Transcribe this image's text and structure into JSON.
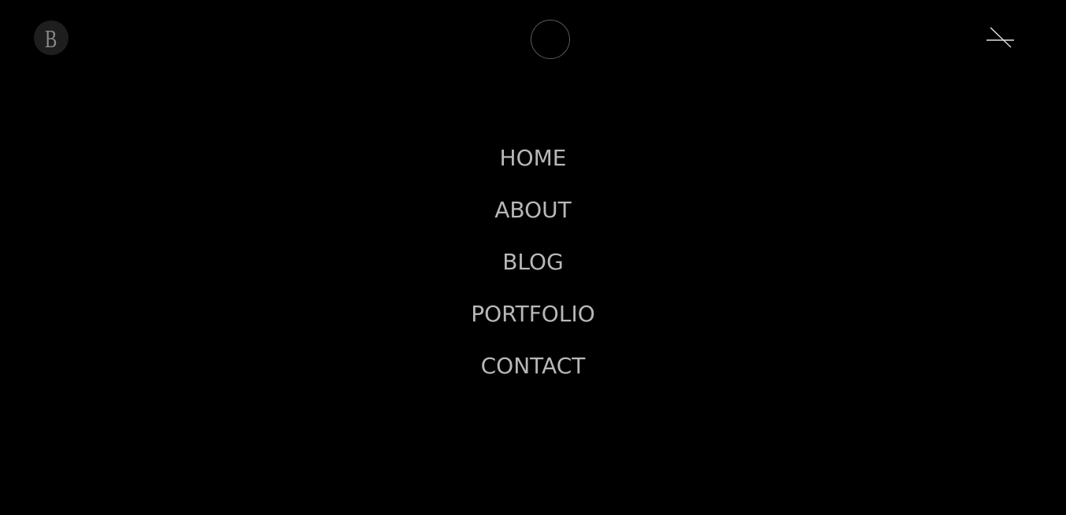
{
  "logo": {
    "letter": "B"
  },
  "nav": {
    "items": [
      {
        "label": "HOME"
      },
      {
        "label": "ABOUT"
      },
      {
        "label": "BLOG"
      },
      {
        "label": "PORTFOLIO"
      },
      {
        "label": "CONTACT"
      }
    ]
  },
  "icons": {
    "logo": "logo-icon",
    "cursor": "cursor-ring",
    "close": "close-icon"
  },
  "colors": {
    "background": "#000000",
    "nav_text": "#b8b8b8",
    "logo_bg": "#1e1e1e",
    "logo_text": "#8a8a8a",
    "ring": "#5a5a5a",
    "close_stroke": "#e0e0e0"
  }
}
